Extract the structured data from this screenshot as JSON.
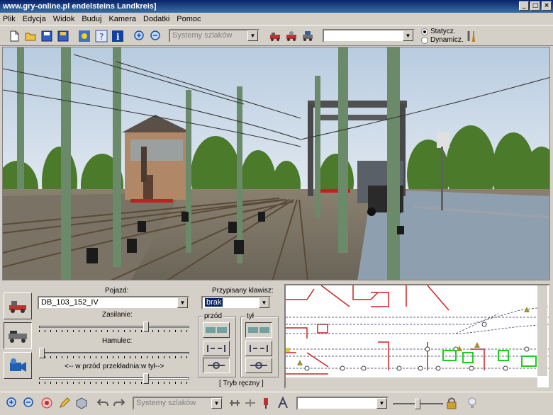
{
  "window": {
    "title": "www.gry-online.pl endelsteins Landkreis]",
    "controls": {
      "minimize": "_",
      "maximize": "□",
      "close": "×"
    }
  },
  "menu": [
    "Plik",
    "Edycja",
    "Widok",
    "Buduj",
    "Kamera",
    "Dodatki",
    "Pomoc"
  ],
  "toolbar": {
    "systems_combo": "Systemy szlaków",
    "right_combo": "",
    "radio_static": "Statycz.",
    "radio_dynamic": "Dynamicz.",
    "radio_selected": "static"
  },
  "control_panel": {
    "vehicle_label": "Pojazd:",
    "vehicle_value": "DB_103_152_IV",
    "key_label": "Przypisany klawisz:",
    "key_value": "brak",
    "power_label": "Zasilanie:",
    "brake_label": "Hamulec:",
    "gear_left": "<-- w przód",
    "gear_mid": "przekładnia:",
    "gear_right": "w tył-->",
    "power_level": 0.72,
    "brake_level": 0.0,
    "gear_level": 0.72,
    "front_label": "przód",
    "back_label": "tył",
    "mode_label": "[ Tryb ręczny ]"
  },
  "statusbar": {
    "systems_combo": "Systemy szlaków",
    "right_combo": ""
  },
  "colors": {
    "title_start": "#0a246a",
    "title_end": "#3a6ea5",
    "map_red": "#cc2222",
    "map_green": "#22cc22",
    "sky": "#c8d8e8",
    "mast": "#6a8a6a"
  }
}
